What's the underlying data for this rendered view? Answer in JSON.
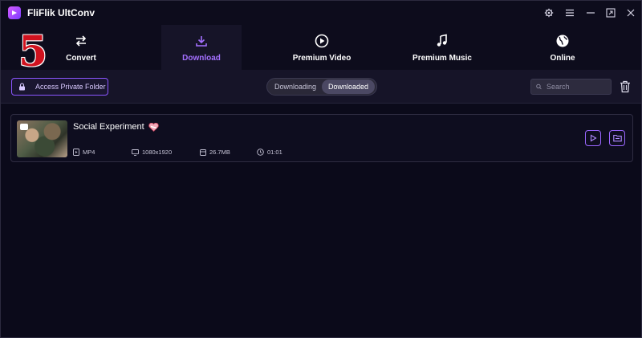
{
  "app": {
    "title": "FliFlik UltConv",
    "step_number": "5"
  },
  "window_controls": {
    "settings_icon": "gear-icon",
    "menu_icon": "menu-icon",
    "minimize_icon": "minimize-icon",
    "maximize_icon": "maximize-icon",
    "close_icon": "close-icon"
  },
  "tabs": [
    {
      "label": "Convert",
      "icon": "convert-arrows-icon",
      "active": false
    },
    {
      "label": "Download",
      "icon": "download-icon",
      "active": true
    },
    {
      "label": "Premium Video",
      "icon": "play-circle-icon",
      "active": false
    },
    {
      "label": "Premium Music",
      "icon": "music-note-icon",
      "active": false
    },
    {
      "label": "Online",
      "icon": "globe-icon",
      "active": false
    }
  ],
  "toolbar": {
    "private_folder_label": "Access Private Folder",
    "segment": {
      "downloading": "Downloading",
      "downloaded": "Downloaded",
      "selected": "Downloaded"
    },
    "search_placeholder": "Search"
  },
  "items": [
    {
      "title": "Social Experiment",
      "format": "MP4",
      "resolution": "1080x1920",
      "size": "26.7MB",
      "duration": "01:01"
    }
  ],
  "colors": {
    "accent": "#a470ff",
    "background": "#0b0a1a",
    "panel": "#161428",
    "step_number": "#d0121e"
  }
}
